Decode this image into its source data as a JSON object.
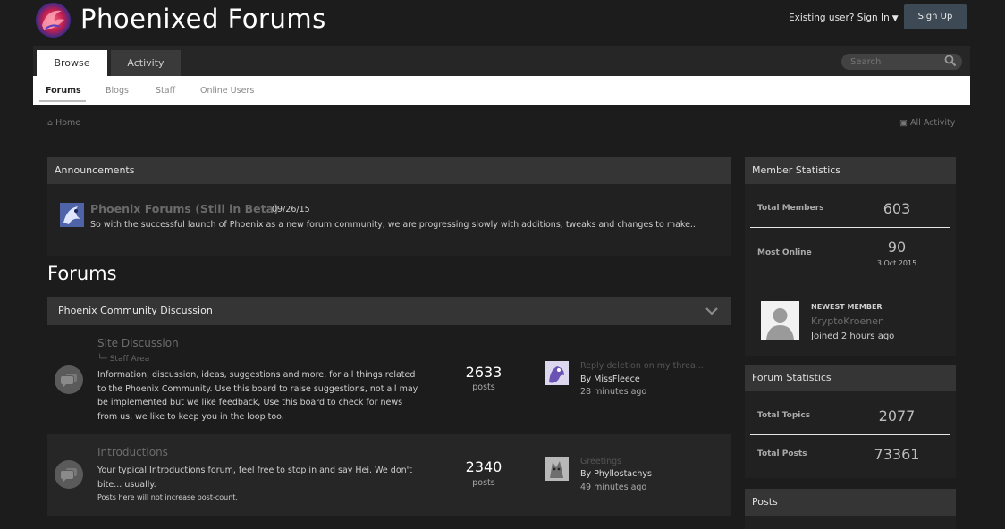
{
  "header": {
    "site_title": "Phoenixed Forums",
    "signin_label": "Existing user? Sign In",
    "signup_label": "Sign Up"
  },
  "nav": {
    "tabs": [
      {
        "label": "Browse"
      },
      {
        "label": "Activity"
      }
    ],
    "search_placeholder": "Search",
    "subnav": [
      {
        "label": "Forums"
      },
      {
        "label": "Blogs"
      },
      {
        "label": "Staff"
      },
      {
        "label": "Online Users"
      }
    ]
  },
  "breadcrumb": {
    "home": "Home",
    "all_activity": "All Activity"
  },
  "announcements": {
    "heading": "Announcements",
    "item": {
      "title": "Phoenix Forums (Still in Beta)",
      "date": "09/26/15",
      "excerpt": "So with the successful launch of Phoenix as a new forum community, we are progressing slowly with additions, tweaks and changes to make..."
    }
  },
  "forums": {
    "heading": "Forums",
    "category": "Phoenix Community Discussion",
    "rows": [
      {
        "name": "Site Discussion",
        "subforum": "Staff Area",
        "desc_lines": [
          "Information, discussion, ideas, suggestions and more, for all things related",
          "to the Phoenix Community. Use this board to raise suggestions, not all may",
          "be implemented but we like feedback, Use this board to check for news",
          "from us, we like to keep you in the loop too."
        ],
        "count": "2633",
        "count_label": "posts",
        "last_title": "Reply deletion on my threa...",
        "last_by": "By MissFleece",
        "last_time": "28 minutes ago"
      },
      {
        "name": "Introductions",
        "desc_lines": [
          "Your typical Introductions forum, feel free to stop in and say Hei. We don't",
          "bite... usually."
        ],
        "note": "Posts here will not increase post-count.",
        "count": "2340",
        "count_label": "posts",
        "last_title": "Greetings",
        "last_by": "By Phyllostachys",
        "last_time": "49 minutes ago"
      }
    ]
  },
  "sidebar": {
    "member_stats": {
      "heading": "Member Statistics",
      "total_members_label": "Total Members",
      "total_members": "603",
      "most_online_label": "Most Online",
      "most_online": "90",
      "most_online_date": "3 Oct 2015",
      "newest_label": "NEWEST MEMBER",
      "newest_name": "KryptoKroenen",
      "newest_joined": "Joined 2 hours ago"
    },
    "forum_stats": {
      "heading": "Forum Statistics",
      "total_topics_label": "Total Topics",
      "total_topics": "2077",
      "total_posts_label": "Total Posts",
      "total_posts": "73361"
    },
    "posts_heading": "Posts"
  },
  "icons": {
    "logo": "phoenix-logo-icon",
    "caret": "caret-down-icon",
    "search": "search-icon",
    "home": "home-icon",
    "activity": "activity-icon",
    "chevron": "chevron-down-icon",
    "forum": "chat-bubbles-icon"
  }
}
